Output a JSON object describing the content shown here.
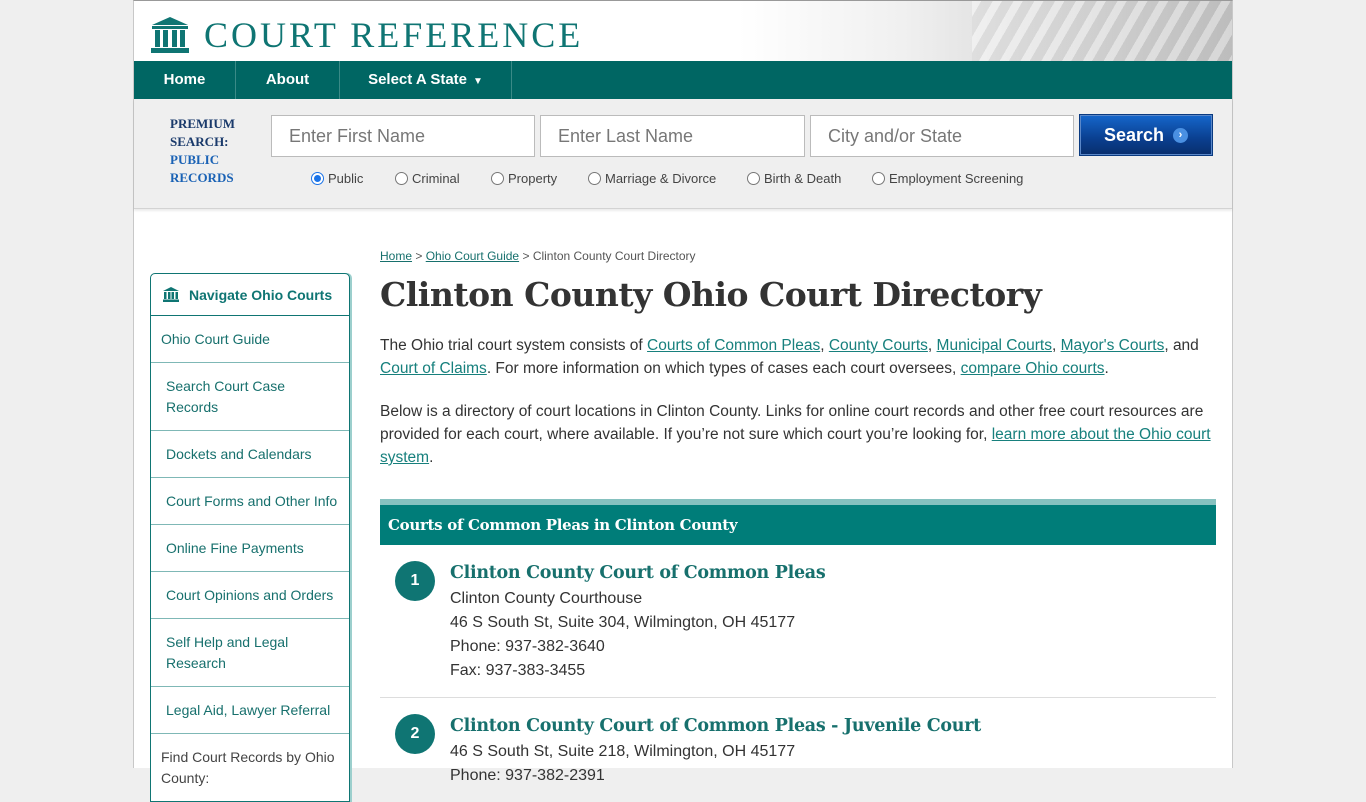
{
  "site": {
    "logo_text": "COURT REFERENCE"
  },
  "nav": {
    "home": "Home",
    "about": "About",
    "select_state": "Select A State",
    "caret": "▼"
  },
  "search": {
    "premium_line1": "PREMIUM",
    "premium_line2": "SEARCH:",
    "premium_line3": "PUBLIC",
    "premium_line4": "RECORDS",
    "first_name_placeholder": "Enter First Name",
    "last_name_placeholder": "Enter Last Name",
    "city_placeholder": "City and/or State",
    "button_label": "Search",
    "button_arrow": "›",
    "record_types": [
      {
        "label": "Public",
        "selected": true
      },
      {
        "label": "Criminal",
        "selected": false
      },
      {
        "label": "Property",
        "selected": false
      },
      {
        "label": "Marriage & Divorce",
        "selected": false
      },
      {
        "label": "Birth & Death",
        "selected": false
      },
      {
        "label": "Employment Screening",
        "selected": false
      }
    ]
  },
  "sidebar": {
    "title": "Navigate Ohio Courts",
    "items": [
      {
        "label": "Ohio Court Guide"
      },
      {
        "label": "Search Court Case Records"
      },
      {
        "label": "Dockets and Calendars"
      },
      {
        "label": "Court Forms and Other Info"
      },
      {
        "label": "Online Fine Payments"
      },
      {
        "label": "Court Opinions and Orders"
      },
      {
        "label": "Self Help and Legal Research"
      },
      {
        "label": "Legal Aid, Lawyer Referral"
      },
      {
        "label": "Find Court Records by Ohio County:"
      }
    ]
  },
  "breadcrumb": {
    "home": "Home",
    "sep": ">",
    "guide": "Ohio Court Guide",
    "current": "Clinton County Court Directory"
  },
  "page_title": "Clinton County Ohio Court Directory",
  "intro": {
    "p1_start": "The Ohio trial court system consists of ",
    "link_common_pleas": "Courts of Common Pleas",
    "comma": ", ",
    "link_county": "County Courts",
    "link_municipal": "Municipal Courts",
    "link_mayors": "Mayor's Courts",
    "and": ", and ",
    "link_claims": "Court of Claims",
    "p1_mid": ". For more information on which types of cases each court oversees, ",
    "link_compare": "compare Ohio courts",
    "period": ".",
    "p2_start": "Below is a directory of court locations in Clinton County. Links for online court records and other free court resources are provided for each court, where available. If you’re not sure which court you’re looking for, ",
    "link_learn": "learn more about the Ohio court system",
    "p2_end": "."
  },
  "section": {
    "title": "Courts of Common Pleas in Clinton County",
    "courts": [
      {
        "num": "1",
        "name": "Clinton County Court of Common Pleas",
        "lines": [
          "Clinton County Courthouse",
          "46 S South St, Suite 304, Wilmington, OH 45177",
          "Phone: 937-382-3640",
          "Fax: 937-383-3455"
        ]
      },
      {
        "num": "2",
        "name": "Clinton County Court of Common Pleas - Juvenile Court",
        "lines": [
          "46 S South St, Suite 218, Wilmington, OH 45177",
          "Phone: 937-382-2391"
        ]
      }
    ]
  },
  "colors": {
    "brand_teal": "#006663",
    "link_teal": "#17706d",
    "search_blue": "#0a3f8f"
  }
}
